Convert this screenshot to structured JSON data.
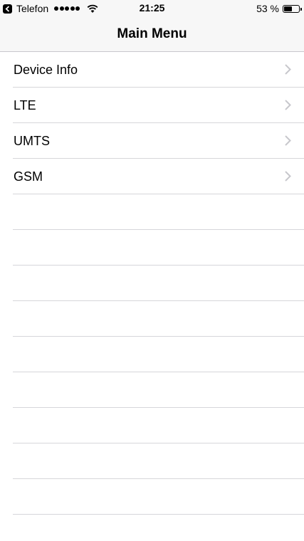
{
  "status_bar": {
    "back_app": "Telefon",
    "signal_dots": 5,
    "time": "21:25",
    "battery_percent_text": "53 %",
    "battery_level": 0.53
  },
  "nav": {
    "title": "Main Menu"
  },
  "menu": {
    "items": [
      {
        "label": "Device Info"
      },
      {
        "label": "LTE"
      },
      {
        "label": "UMTS"
      },
      {
        "label": "GSM"
      }
    ]
  },
  "colors": {
    "bar_background": "#f7f7f7",
    "separator": "#d6d6da",
    "chevron": "#c7c7cc"
  }
}
